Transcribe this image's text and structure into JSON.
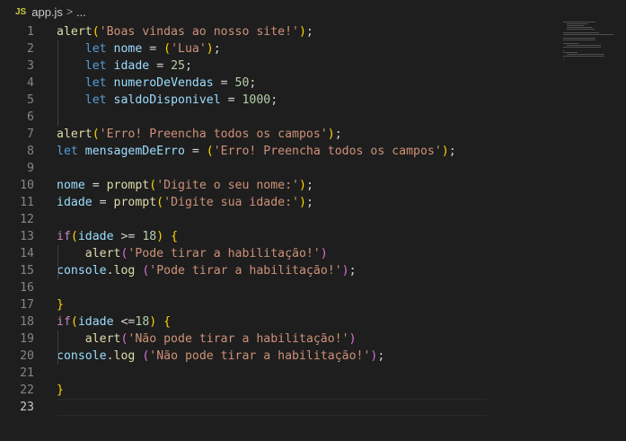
{
  "breadcrumb": {
    "file_icon": "JS",
    "file_name": "app.js",
    "separator": ">",
    "more": "..."
  },
  "editor": {
    "active_line": 23,
    "lines": [
      {
        "n": "1",
        "indent": 0,
        "tokens": [
          [
            "fn",
            "alert"
          ],
          [
            "p1",
            "("
          ],
          [
            "str",
            "'Boas vindas ao nosso site!'"
          ],
          [
            "p1",
            ")"
          ],
          [
            "op",
            ";"
          ]
        ]
      },
      {
        "n": "2",
        "indent": 1,
        "tokens": [
          [
            "kw",
            "let"
          ],
          [
            "op",
            " "
          ],
          [
            "var",
            "nome"
          ],
          [
            "op",
            " = "
          ],
          [
            "p1",
            "("
          ],
          [
            "str",
            "'Lua'"
          ],
          [
            "p1",
            ")"
          ],
          [
            "op",
            ";"
          ]
        ]
      },
      {
        "n": "3",
        "indent": 1,
        "tokens": [
          [
            "kw",
            "let"
          ],
          [
            "op",
            " "
          ],
          [
            "var",
            "idade"
          ],
          [
            "op",
            " = "
          ],
          [
            "num",
            "25"
          ],
          [
            "op",
            ";"
          ]
        ]
      },
      {
        "n": "4",
        "indent": 1,
        "tokens": [
          [
            "kw",
            "let"
          ],
          [
            "op",
            " "
          ],
          [
            "var",
            "numeroDeVendas"
          ],
          [
            "op",
            " = "
          ],
          [
            "num",
            "50"
          ],
          [
            "op",
            ";"
          ]
        ]
      },
      {
        "n": "5",
        "indent": 1,
        "tokens": [
          [
            "kw",
            "let"
          ],
          [
            "op",
            " "
          ],
          [
            "var",
            "saldoDisponivel"
          ],
          [
            "op",
            " = "
          ],
          [
            "num",
            "1000"
          ],
          [
            "op",
            ";"
          ]
        ]
      },
      {
        "n": "6",
        "indent": 0,
        "tokens": []
      },
      {
        "n": "7",
        "indent": 0,
        "tokens": [
          [
            "fn",
            "alert"
          ],
          [
            "p1",
            "("
          ],
          [
            "str",
            "'Erro! Preencha todos os campos'"
          ],
          [
            "p1",
            ")"
          ],
          [
            "op",
            ";"
          ]
        ]
      },
      {
        "n": "8",
        "indent": 0,
        "tokens": [
          [
            "kw",
            "let"
          ],
          [
            "op",
            " "
          ],
          [
            "var",
            "mensagemDeErro"
          ],
          [
            "op",
            " = "
          ],
          [
            "p1",
            "("
          ],
          [
            "str",
            "'Erro! Preencha todos os campos'"
          ],
          [
            "p1",
            ")"
          ],
          [
            "op",
            ";"
          ]
        ]
      },
      {
        "n": "9",
        "indent": 0,
        "tokens": []
      },
      {
        "n": "10",
        "indent": 0,
        "tokens": [
          [
            "var",
            "nome"
          ],
          [
            "op",
            " = "
          ],
          [
            "fn",
            "prompt"
          ],
          [
            "p1",
            "("
          ],
          [
            "str",
            "'Digite o seu nome:'"
          ],
          [
            "p1",
            ")"
          ],
          [
            "op",
            ";"
          ]
        ]
      },
      {
        "n": "11",
        "indent": 0,
        "tokens": [
          [
            "var",
            "idade"
          ],
          [
            "op",
            " = "
          ],
          [
            "fn",
            "prompt"
          ],
          [
            "p1",
            "("
          ],
          [
            "str",
            "'Digite sua idade:'"
          ],
          [
            "p1",
            ")"
          ],
          [
            "op",
            ";"
          ]
        ]
      },
      {
        "n": "12",
        "indent": 0,
        "tokens": []
      },
      {
        "n": "13",
        "indent": 0,
        "tokens": [
          [
            "ctl",
            "if"
          ],
          [
            "p1",
            "("
          ],
          [
            "var",
            "idade"
          ],
          [
            "op",
            " >= "
          ],
          [
            "num",
            "18"
          ],
          [
            "p1",
            ")"
          ],
          [
            "op",
            " "
          ],
          [
            "p1",
            "{"
          ]
        ]
      },
      {
        "n": "14",
        "indent": 1,
        "tokens": [
          [
            "fn",
            "alert"
          ],
          [
            "p2",
            "("
          ],
          [
            "str",
            "'Pode tirar a habilitação!'"
          ],
          [
            "p2",
            ")"
          ]
        ]
      },
      {
        "n": "15",
        "indent": 0,
        "tokens": [
          [
            "var",
            "console"
          ],
          [
            "op",
            "."
          ],
          [
            "fn",
            "log"
          ],
          [
            "op",
            " "
          ],
          [
            "p2",
            "("
          ],
          [
            "str",
            "'Pode tirar a habilitação!'"
          ],
          [
            "p2",
            ")"
          ],
          [
            "op",
            ";"
          ]
        ]
      },
      {
        "n": "16",
        "indent": 0,
        "tokens": []
      },
      {
        "n": "17",
        "indent": 0,
        "tokens": [
          [
            "p1",
            "}"
          ]
        ]
      },
      {
        "n": "18",
        "indent": 0,
        "tokens": [
          [
            "ctl",
            "if"
          ],
          [
            "p1",
            "("
          ],
          [
            "var",
            "idade"
          ],
          [
            "op",
            " <="
          ],
          [
            "num",
            "18"
          ],
          [
            "p1",
            ")"
          ],
          [
            "op",
            " "
          ],
          [
            "p1",
            "{"
          ]
        ]
      },
      {
        "n": "19",
        "indent": 1,
        "tokens": [
          [
            "fn",
            "alert"
          ],
          [
            "p2",
            "("
          ],
          [
            "str",
            "'Não pode tirar a habilitação!'"
          ],
          [
            "p2",
            ")"
          ]
        ]
      },
      {
        "n": "20",
        "indent": 0,
        "tokens": [
          [
            "var",
            "console"
          ],
          [
            "op",
            "."
          ],
          [
            "fn",
            "log"
          ],
          [
            "op",
            " "
          ],
          [
            "p2",
            "("
          ],
          [
            "str",
            "'Não pode tirar a habilitação!'"
          ],
          [
            "p2",
            ")"
          ],
          [
            "op",
            ";"
          ]
        ]
      },
      {
        "n": "21",
        "indent": 0,
        "tokens": []
      },
      {
        "n": "22",
        "indent": 0,
        "tokens": [
          [
            "p1",
            "}"
          ]
        ]
      },
      {
        "n": "23",
        "indent": 0,
        "tokens": []
      }
    ]
  },
  "colors": {
    "background": "#1e1e1e",
    "function": "#dcdcaa",
    "string": "#ce9178",
    "keyword": "#569cd6",
    "control": "#c586c0",
    "variable": "#9cdcfe",
    "number": "#b5cea8",
    "bracket_1": "#ffd700",
    "bracket_2": "#da70d6"
  }
}
